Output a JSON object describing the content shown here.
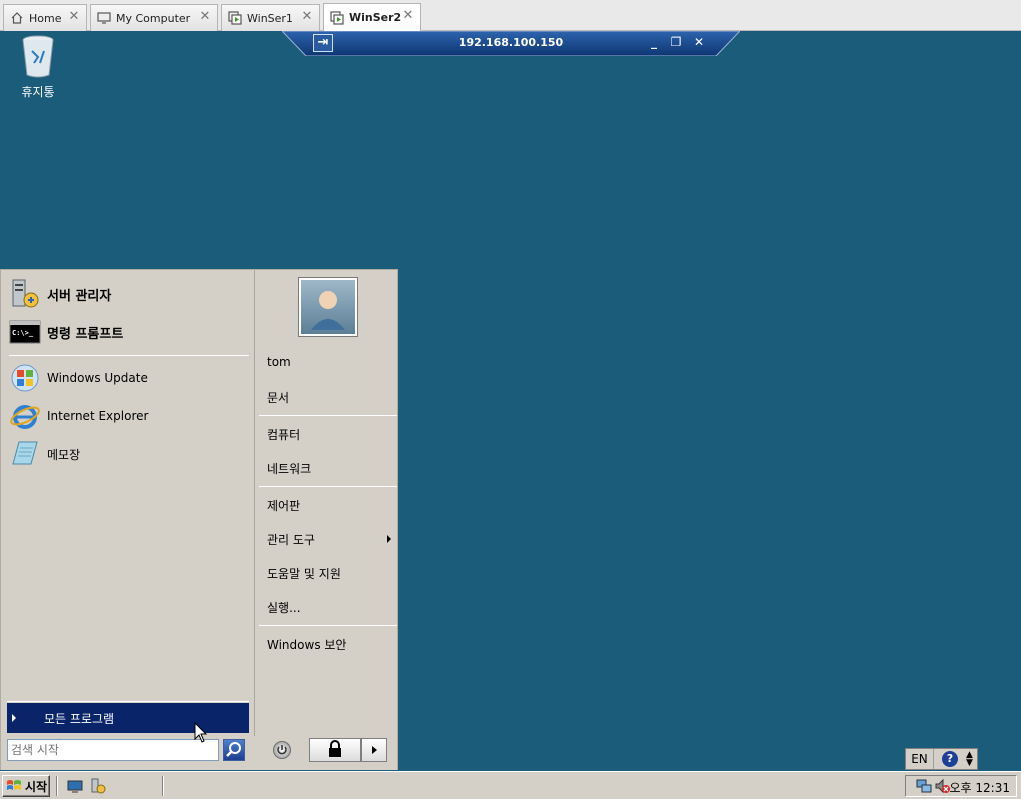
{
  "tabs": [
    {
      "label": "Home",
      "icon": "home-icon"
    },
    {
      "label": "My Computer",
      "icon": "monitor-icon"
    },
    {
      "label": "WinSer1",
      "icon": "vm-icon"
    },
    {
      "label": "WinSer2",
      "icon": "vm-icon",
      "active": true
    }
  ],
  "remote_bar": {
    "title": "192.168.100.150"
  },
  "desktop": {
    "recycle_bin_label": "휴지통",
    "background_color": "#1a5c7a"
  },
  "start_menu": {
    "pinned": [
      {
        "label": "서버 관리자",
        "icon": "server-manager-icon"
      },
      {
        "label": "명령 프롬프트",
        "icon": "command-prompt-icon"
      }
    ],
    "recent": [
      {
        "label": "Windows Update",
        "icon": "windows-update-icon"
      },
      {
        "label": "Internet Explorer",
        "icon": "internet-explorer-icon"
      },
      {
        "label": "메모장",
        "icon": "notepad-icon"
      }
    ],
    "all_programs_label": "모든 프로그램",
    "search_placeholder": "검색 시작",
    "right": {
      "user": "tom",
      "documents": "문서",
      "computer": "컴퓨터",
      "network": "네트워크",
      "control_panel": "제어판",
      "admin_tools": "관리 도구",
      "help": "도움말 및 지원",
      "run": "실행...",
      "security": "Windows 보안"
    }
  },
  "taskbar": {
    "start_label": "시작",
    "language": "EN",
    "help_symbol": "?",
    "clock": "오후 12:31"
  },
  "colors": {
    "selection": "#0a246a",
    "menu_bg": "#d4d0c8"
  }
}
